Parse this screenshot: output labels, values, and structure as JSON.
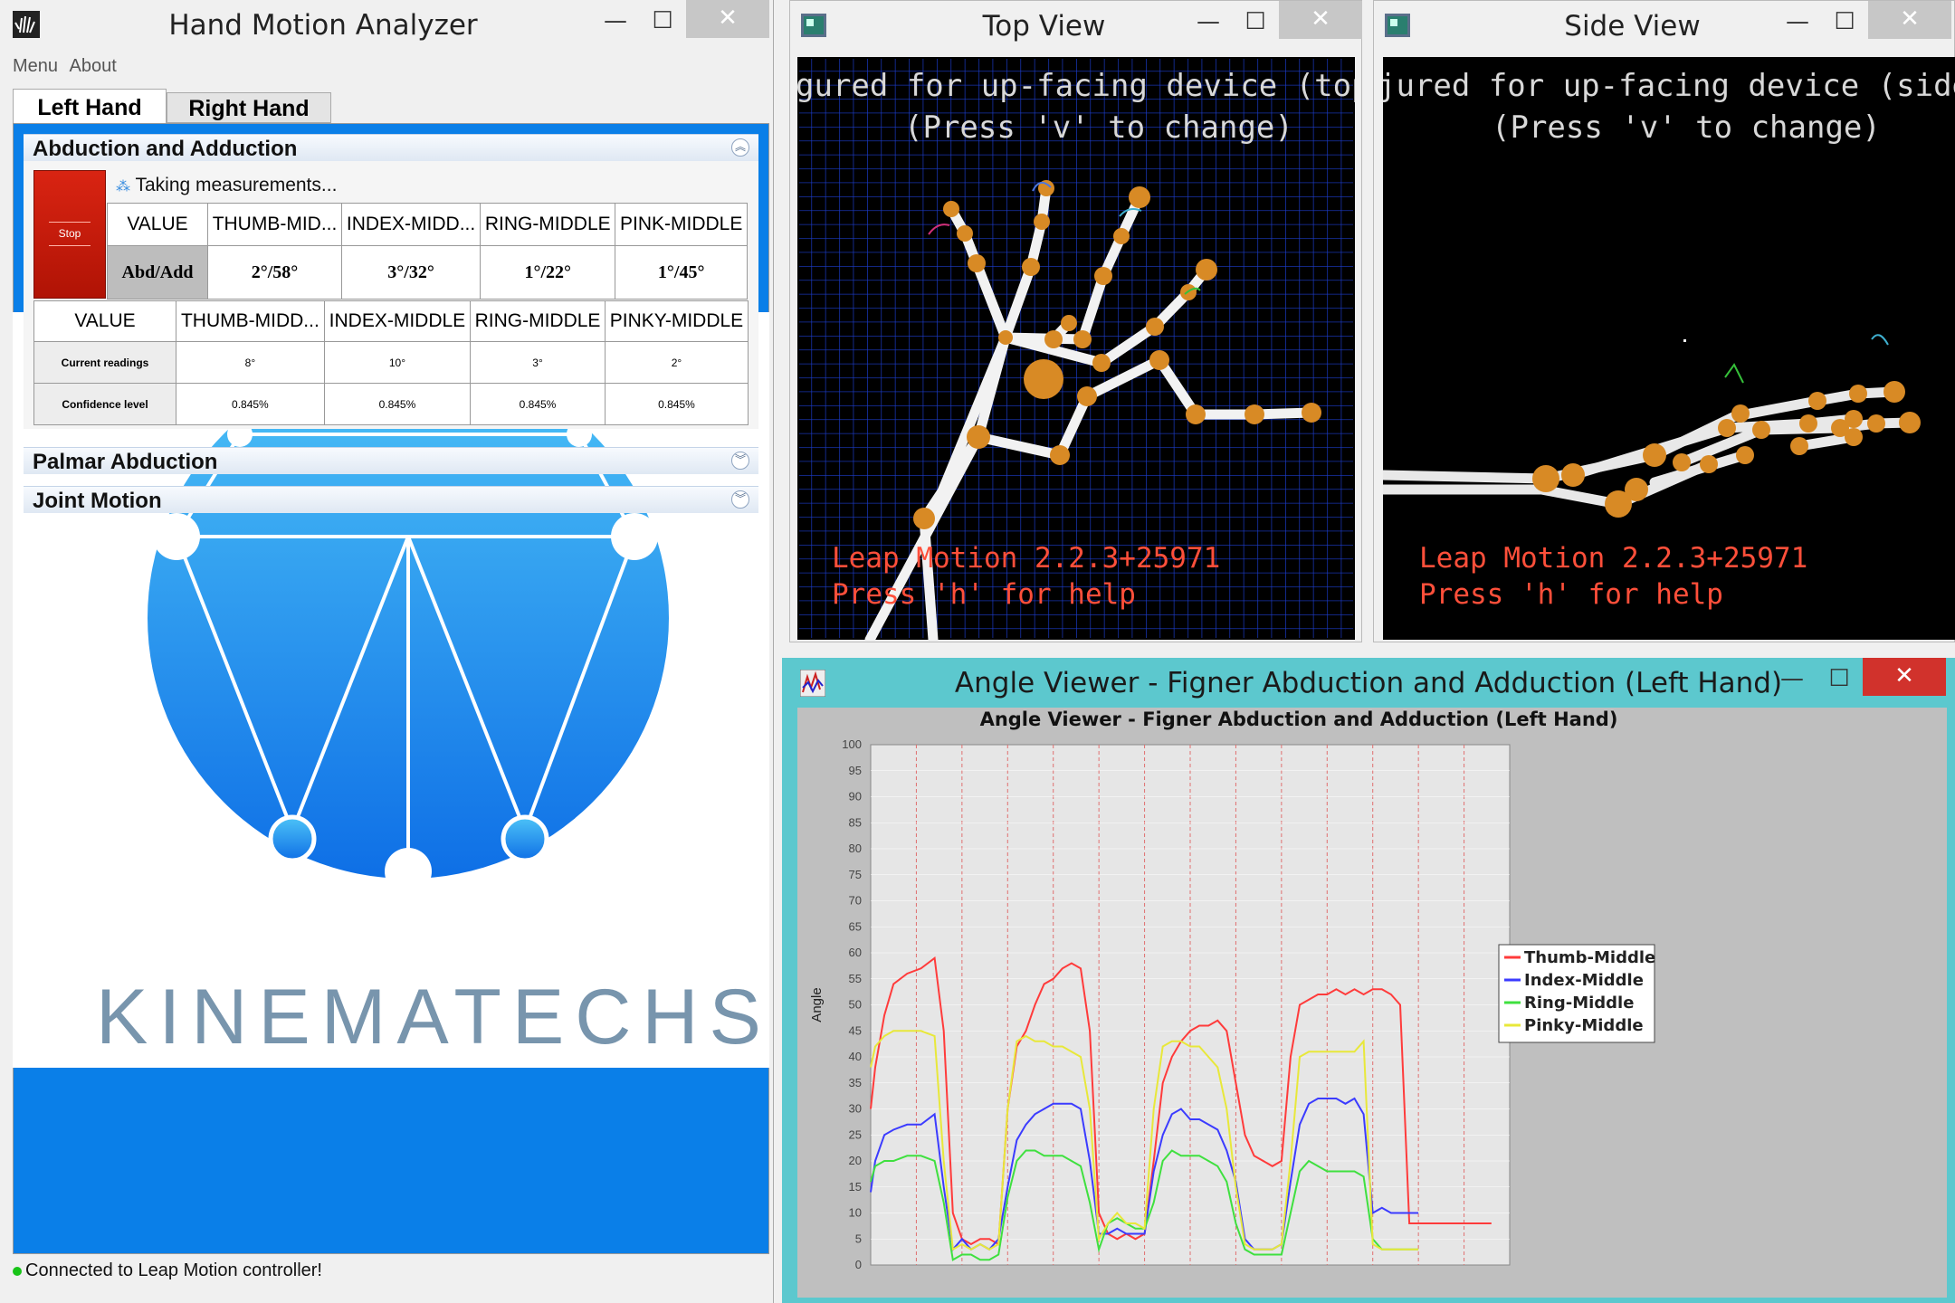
{
  "main": {
    "title": "Hand Motion Analyzer",
    "menu": [
      "Menu",
      "About"
    ],
    "tabs": [
      "Left Hand",
      "Right Hand"
    ],
    "sections": [
      "Abduction and Adduction",
      "Palmar Abduction",
      "Joint Motion"
    ],
    "stop_label": "Stop",
    "status_message": "Taking measurements...",
    "small_table": {
      "headers": [
        "VALUE",
        "THUMB-MID...",
        "INDEX-MIDD...",
        "RING-MIDDLE",
        "PINK-MIDDLE"
      ],
      "row_label": "Abd/Add",
      "values": [
        "2°/58°",
        "3°/32°",
        "1°/22°",
        "1°/45°"
      ]
    },
    "big_table": {
      "headers": [
        "VALUE",
        "THUMB-MIDD...",
        "INDEX-MIDDLE",
        "RING-MIDDLE",
        "PINKY-MIDDLE"
      ],
      "rows": [
        {
          "label": "Current readings",
          "values": [
            "8°",
            "10°",
            "3°",
            "2°"
          ]
        },
        {
          "label": "Confidence level",
          "values": [
            "0.845%",
            "0.845%",
            "0.845%",
            "0.845%"
          ]
        }
      ]
    },
    "logo_text": "KINEMATECHS",
    "status_bar": "Connected to Leap Motion controller!"
  },
  "top_view": {
    "title": "Top View",
    "line1": "gured for up-facing device (top",
    "line2": "(Press 'v' to change)",
    "footer1": "Leap Motion 2.2.3+25971",
    "footer2": "Press 'h' for help"
  },
  "side_view": {
    "title": "Side View",
    "line1": "jured for up-facing device (side",
    "line2": "(Press 'v' to change)",
    "footer1": "Leap Motion 2.2.3+25971",
    "footer2": "Press 'h' for help"
  },
  "angle_window": {
    "title": "Angle Viewer - Figner Abduction and Adduction (Left Hand)"
  },
  "window_buttons": {
    "minimize": "—",
    "maximize": "☐",
    "close": "✕"
  },
  "colors": {
    "accent_blue": "#0a7fe8",
    "stop_red": "#c81c0c",
    "chart_bg": "#bfbfbf",
    "plot_bg": "#e6e6e6"
  },
  "chart_data": {
    "type": "line",
    "title": "Angle Viewer - Figner Abduction and Adduction (Left Hand)",
    "xlabel": "",
    "ylabel": "Angle",
    "ylim": [
      0,
      100
    ],
    "yticks": [
      0,
      5,
      10,
      15,
      20,
      25,
      30,
      35,
      40,
      45,
      50,
      55,
      60,
      65,
      70,
      75,
      80,
      85,
      90,
      95,
      100
    ],
    "xlim": [
      0,
      140
    ],
    "grid": true,
    "legend": "right",
    "series": [
      {
        "name": "Thumb-Middle",
        "color": "#ff3b3b",
        "x": [
          0,
          1,
          3,
          5,
          8,
          11,
          14,
          16,
          18,
          20,
          22,
          24,
          26,
          28,
          30,
          32,
          34,
          36,
          38,
          40,
          42,
          44,
          46,
          48,
          50,
          52,
          54,
          56,
          58,
          60,
          62,
          64,
          66,
          68,
          70,
          72,
          74,
          76,
          78,
          80,
          82,
          84,
          86,
          88,
          90,
          92,
          94,
          96,
          98,
          100,
          102,
          104,
          106,
          108,
          110,
          112,
          114,
          116,
          118,
          120,
          122,
          124,
          126,
          128,
          130,
          132,
          134,
          136
        ],
        "y": [
          30,
          38,
          48,
          54,
          56,
          57,
          59,
          45,
          10,
          5,
          4,
          5,
          5,
          4,
          30,
          42,
          45,
          50,
          54,
          55,
          57,
          58,
          57,
          45,
          10,
          6,
          5,
          6,
          5,
          6,
          20,
          35,
          40,
          43,
          45,
          46,
          46,
          47,
          45,
          35,
          25,
          21,
          20,
          19,
          20,
          40,
          50,
          51,
          52,
          52,
          53,
          52,
          53,
          52,
          53,
          53,
          52,
          50,
          8,
          8,
          8,
          8,
          8,
          8,
          8,
          8,
          8,
          8
        ]
      },
      {
        "name": "Index-Middle",
        "color": "#3b3bff",
        "x": [
          0,
          1,
          3,
          5,
          8,
          11,
          14,
          16,
          18,
          20,
          22,
          24,
          26,
          28,
          30,
          32,
          34,
          36,
          38,
          40,
          42,
          44,
          46,
          48,
          50,
          52,
          54,
          56,
          58,
          60,
          62,
          64,
          66,
          68,
          70,
          72,
          74,
          76,
          78,
          80,
          82,
          84,
          86,
          88,
          90,
          92,
          94,
          96,
          98,
          100,
          102,
          104,
          106,
          108,
          110,
          112,
          114,
          116,
          118,
          120
        ],
        "y": [
          14,
          20,
          25,
          26,
          27,
          27,
          29,
          15,
          3,
          5,
          3,
          4,
          3,
          5,
          15,
          24,
          27,
          29,
          30,
          31,
          31,
          31,
          30,
          20,
          6,
          6,
          7,
          6,
          6,
          6,
          18,
          25,
          29,
          30,
          28,
          28,
          27,
          26,
          22,
          16,
          5,
          3,
          3,
          3,
          4,
          16,
          27,
          31,
          32,
          32,
          32,
          31,
          32,
          29,
          10,
          11,
          10,
          10,
          10,
          10
        ]
      },
      {
        "name": "Ring-Middle",
        "color": "#3fe03f",
        "x": [
          0,
          1,
          3,
          5,
          8,
          11,
          14,
          16,
          18,
          20,
          22,
          24,
          26,
          28,
          30,
          32,
          34,
          36,
          38,
          40,
          42,
          44,
          46,
          48,
          50,
          52,
          54,
          56,
          58,
          60,
          62,
          64,
          66,
          68,
          70,
          72,
          74,
          76,
          78,
          80,
          82,
          84,
          86,
          88,
          90,
          92,
          94,
          96,
          98,
          100,
          102,
          104,
          106,
          108,
          110,
          112,
          114,
          116,
          118,
          120
        ],
        "y": [
          16,
          19,
          20,
          20,
          21,
          21,
          20,
          12,
          1,
          2,
          2,
          1,
          1,
          2,
          13,
          20,
          22,
          22,
          21,
          21,
          21,
          20,
          19,
          12,
          3,
          8,
          9,
          8,
          7,
          7,
          12,
          20,
          22,
          21,
          21,
          21,
          20,
          19,
          16,
          8,
          3,
          2,
          2,
          2,
          2,
          10,
          18,
          20,
          19,
          18,
          18,
          18,
          18,
          17,
          5,
          3,
          3,
          3,
          3,
          3
        ]
      },
      {
        "name": "Pinky-Middle",
        "color": "#e8e83a",
        "x": [
          0,
          1,
          3,
          5,
          8,
          11,
          14,
          16,
          18,
          20,
          22,
          24,
          26,
          28,
          30,
          32,
          34,
          36,
          38,
          40,
          42,
          44,
          46,
          48,
          50,
          52,
          54,
          56,
          58,
          60,
          62,
          64,
          66,
          68,
          70,
          72,
          74,
          76,
          78,
          80,
          82,
          84,
          86,
          88,
          90,
          92,
          94,
          96,
          98,
          100,
          102,
          104,
          106,
          108,
          110,
          112,
          114,
          116,
          118,
          120
        ],
        "y": [
          38,
          42,
          44,
          45,
          45,
          45,
          44,
          20,
          3,
          4,
          3,
          4,
          3,
          4,
          30,
          43,
          44,
          43,
          43,
          42,
          42,
          41,
          40,
          30,
          5,
          8,
          10,
          8,
          8,
          7,
          30,
          42,
          43,
          43,
          42,
          42,
          40,
          38,
          30,
          15,
          4,
          3,
          3,
          3,
          4,
          20,
          40,
          41,
          41,
          41,
          41,
          41,
          41,
          43,
          4,
          3,
          3,
          3,
          3,
          3
        ]
      }
    ]
  }
}
